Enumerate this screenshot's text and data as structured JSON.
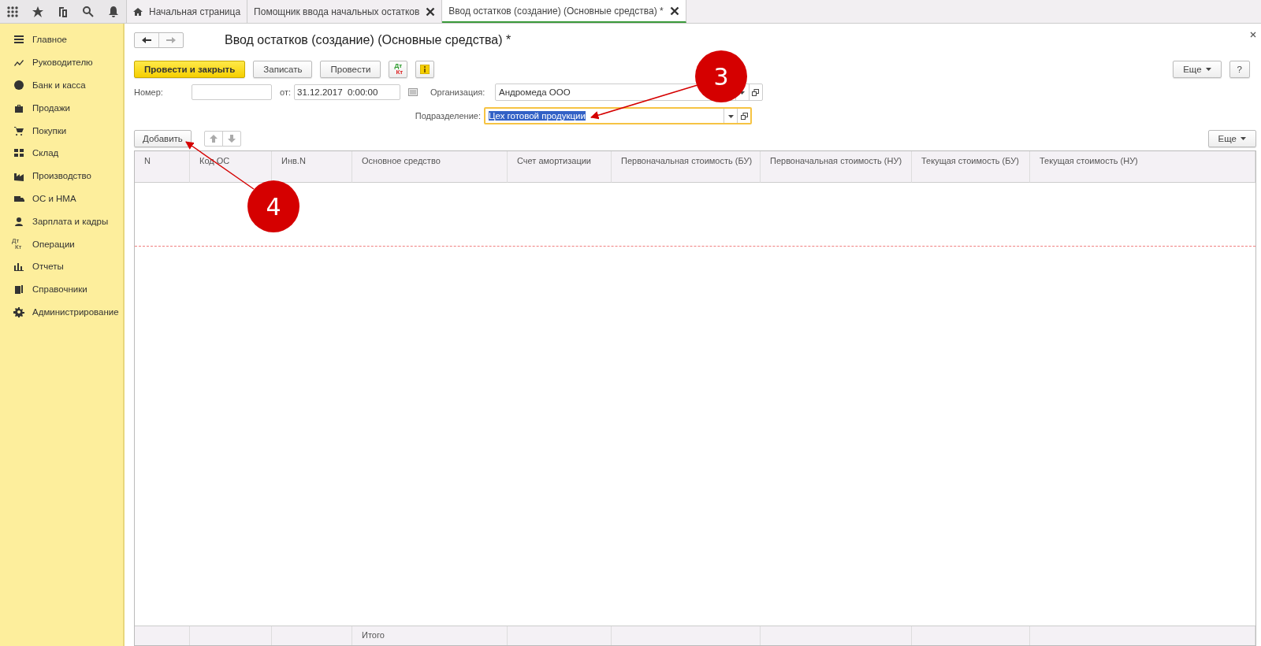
{
  "tabs": [
    {
      "label": "Начальная страница",
      "kind": "home",
      "selected": false
    },
    {
      "label": "Помощник ввода начальных остатков",
      "kind": "closable",
      "selected": false
    },
    {
      "label": "Ввод остатков (создание) (Основные средства) *",
      "kind": "closable",
      "selected": true
    }
  ],
  "sidebar": {
    "items": [
      {
        "label": "Главное"
      },
      {
        "label": "Руководителю"
      },
      {
        "label": "Банк и касса"
      },
      {
        "label": "Продажи"
      },
      {
        "label": "Покупки"
      },
      {
        "label": "Склад"
      },
      {
        "label": "Производство"
      },
      {
        "label": "ОС и НМА"
      },
      {
        "label": "Зарплата и кадры"
      },
      {
        "label": "Операции",
        "icon_text": [
          "Дт",
          "Кт"
        ]
      },
      {
        "label": "Отчеты"
      },
      {
        "label": "Справочники"
      },
      {
        "label": "Администрирование"
      }
    ]
  },
  "form": {
    "title": "Ввод остатков (создание) (Основные средства) *",
    "toolbar": [
      {
        "kind": "primary",
        "label": "Провести и закрыть"
      },
      {
        "kind": "default",
        "label": "Записать"
      },
      {
        "kind": "default",
        "label": "Провести"
      },
      {
        "kind": "dtkt",
        "icon_text": [
          "Дт",
          "Кт"
        ]
      },
      {
        "kind": "info"
      }
    ],
    "more_button": "Еще",
    "help_button": "?",
    "number": {
      "label": "Номер:"
    },
    "date": {
      "label": "от:",
      "value": "31.12.2017  0:00:00"
    },
    "organization": {
      "label": "Организация:",
      "value": "Андромеда ООО",
      "focused": false
    },
    "subdivision": {
      "label": "Подразделение:",
      "value": "Цех готовой продукции",
      "focused": true
    },
    "table_toolbar": {
      "add_button": "Добавить",
      "more_button": "Еще"
    },
    "table": {
      "columns": [
        "N",
        "Код ОС",
        "Инв.N",
        "Основное средство",
        "Счет амортизации",
        "Первоначальная стоимость (БУ)",
        "Первоначальная стоимость (НУ)",
        "Текущая стоимость (БУ)",
        "Текущая стоимость (НУ)"
      ],
      "total_label": "Итого"
    }
  },
  "annotations": [
    {
      "label": "3"
    },
    {
      "label": "4"
    }
  ]
}
